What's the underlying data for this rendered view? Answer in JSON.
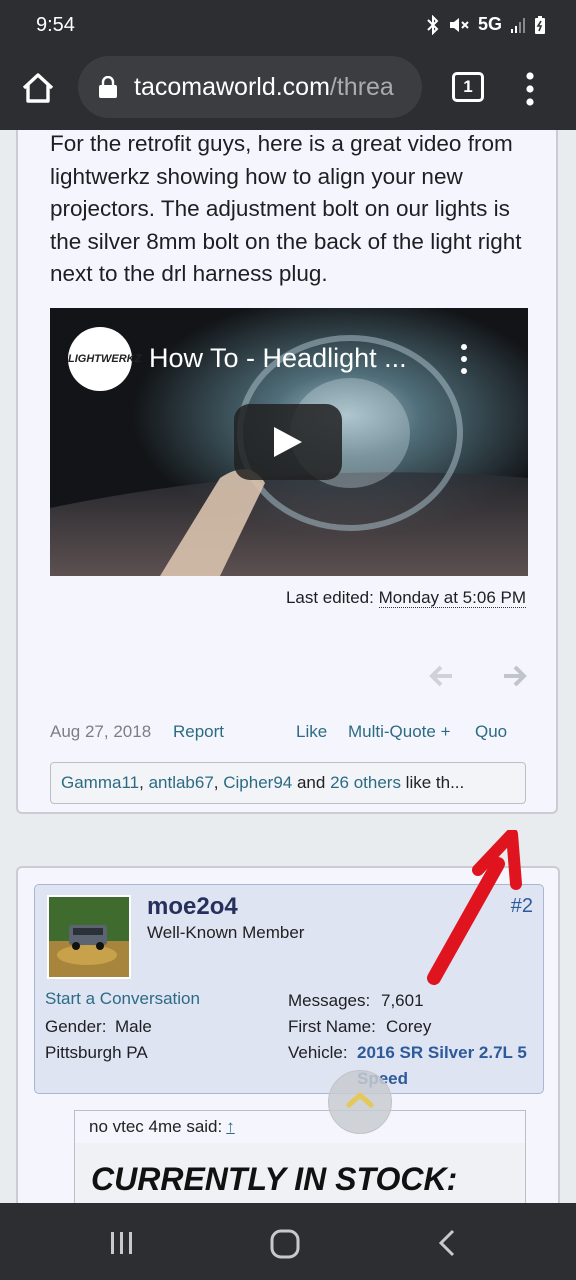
{
  "status_bar": {
    "time": "9:54",
    "network": "5G",
    "icons": [
      "bluetooth-icon",
      "mute-icon",
      "signal-icon",
      "battery-icon"
    ]
  },
  "browser": {
    "url_host": "tacomaworld.com",
    "url_rest": "/threa",
    "tab_count": "1"
  },
  "post1": {
    "text": "For the retrofit guys, here is a great video from lightwerkz showing how to align your new projectors. The adjustment bolt on our lights is the silver 8mm bolt on the back of the light right next to the drl harness plug.",
    "video": {
      "title": "How To - Headlight ...",
      "channel_logo_text": "LIGHTWERKZ"
    },
    "edited_label": "Last edited:",
    "edited_date": "Monday at 5:06 PM",
    "date": "Aug 27, 2018",
    "actions": {
      "report": "Report",
      "like": "Like",
      "multi_quote": "Multi-Quote +",
      "quote": "Quo"
    },
    "likes": {
      "user1": "Gamma11",
      "sep1": ", ",
      "user2": "antlab67",
      "sep2": ", ",
      "user3": "Cipher94",
      "and": " and ",
      "others": "26 others",
      "suffix": " like th..."
    }
  },
  "post2": {
    "username": "moe2o4",
    "user_title": "Well-Known Member",
    "post_number": "#2",
    "start_conversation": "Start a Conversation",
    "gender_label": "Gender:",
    "gender": "Male",
    "location": "Pittsburgh PA",
    "messages_label": "Messages:",
    "messages": "7,601",
    "first_name_label": "First Name:",
    "first_name": "Corey",
    "vehicle_label": "Vehicle:",
    "vehicle": "2016 SR Silver 2.7L 5 Speed",
    "quote_author": "no vtec 4me said:",
    "quote_arrow": "↑",
    "quote_headline": "CURRENTLY IN STOCK:"
  },
  "colors": {
    "link": "#2d6b84",
    "annotation_arrow": "#e0141e",
    "system_bar": "#2c2e31"
  }
}
